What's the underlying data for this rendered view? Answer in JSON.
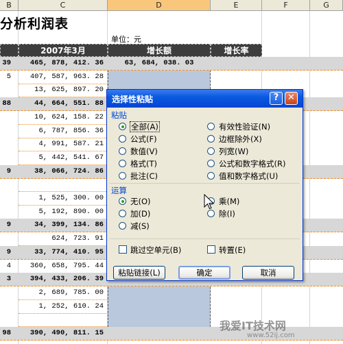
{
  "columns": [
    "B",
    "C",
    "D",
    "E",
    "F",
    "G"
  ],
  "sheet": {
    "title": "分析利润表",
    "unit_label": "单位：元",
    "headers": [
      "2007年3月",
      "增长额",
      "增长率"
    ],
    "rows": [
      {
        "a": "39",
        "c": "465, 878, 412. 36",
        "d": "63, 684, 038. 03",
        "bold": true
      },
      {
        "a": "5",
        "c": "407, 587, 963. 28",
        "d": "",
        "bold": false
      },
      {
        "a": "",
        "c": "13, 625, 897. 20",
        "d": "",
        "bold": false
      },
      {
        "a": "88",
        "c": "44, 664, 551. 88",
        "d": "",
        "bold": true
      },
      {
        "a": "",
        "c": "10, 624, 158. 22",
        "d": "",
        "bold": false
      },
      {
        "a": "",
        "c": "6, 787, 856. 36",
        "d": "",
        "bold": false
      },
      {
        "a": "",
        "c": "4, 991, 587. 21",
        "d": "",
        "bold": false
      },
      {
        "a": "",
        "c": "5, 442, 541. 67",
        "d": "",
        "bold": false
      },
      {
        "a": "9",
        "c": "38, 066, 724. 86",
        "d": "",
        "bold": true
      },
      {
        "a": "",
        "c": "",
        "d": "",
        "bold": false
      },
      {
        "a": "",
        "c": "1, 525, 300. 00",
        "d": "",
        "bold": false
      },
      {
        "a": "",
        "c": "5, 192, 890. 00",
        "d": "",
        "bold": false
      },
      {
        "a": "9",
        "c": "34, 399, 134. 86",
        "d": "",
        "bold": true
      },
      {
        "a": "",
        "c": "624, 723. 91",
        "d": "",
        "bold": false
      },
      {
        "a": "9",
        "c": "33, 774, 410. 95",
        "d": "",
        "bold": true
      },
      {
        "a": "4",
        "c": "360, 658, 795. 44",
        "d": "",
        "bold": false
      },
      {
        "a": "3",
        "c": "394, 433, 206. 39",
        "d": "",
        "bold": true
      },
      {
        "a": "",
        "c": "2, 689, 785. 00",
        "d": "",
        "bold": false
      },
      {
        "a": "",
        "c": "1, 252, 610. 24",
        "d": "",
        "bold": false
      },
      {
        "a": "",
        "c": "",
        "d": "",
        "bold": false
      },
      {
        "a": "98",
        "c": "390, 490, 811. 15",
        "d": "",
        "bold": true
      }
    ]
  },
  "dialog": {
    "title": "选择性粘贴",
    "help_label": "?",
    "close_label": "✕",
    "paste_group": "粘贴",
    "paste_options": [
      {
        "label": "全部(A)",
        "checked": true
      },
      {
        "label": "公式(F)",
        "checked": false
      },
      {
        "label": "数值(V)",
        "checked": false
      },
      {
        "label": "格式(T)",
        "checked": false
      },
      {
        "label": "批注(C)",
        "checked": false
      },
      {
        "label": "有效性验证(N)",
        "checked": false
      },
      {
        "label": "边框除外(X)",
        "checked": false
      },
      {
        "label": "列宽(W)",
        "checked": false
      },
      {
        "label": "公式和数字格式(R)",
        "checked": false
      },
      {
        "label": "值和数字格式(U)",
        "checked": false
      }
    ],
    "op_group": "运算",
    "op_options": [
      {
        "label": "无(O)",
        "checked": true
      },
      {
        "label": "加(D)",
        "checked": false
      },
      {
        "label": "减(S)",
        "checked": false
      },
      {
        "label": "乘(M)",
        "checked": false
      },
      {
        "label": "除(I)",
        "checked": false
      }
    ],
    "skip_blanks": "跳过空单元(B)",
    "transpose": "转置(E)",
    "paste_link_button": "粘贴链接(L)",
    "ok_button": "确定",
    "cancel_button": "取消"
  },
  "watermark": {
    "text": "我爱IT技术网",
    "url": "www.52ij.com"
  },
  "colors": {
    "title_bar": "#0a5ae0",
    "group_label": "#0046d5",
    "selected_column": "#b9c8dd",
    "header_cell": "#3d3d3d"
  }
}
